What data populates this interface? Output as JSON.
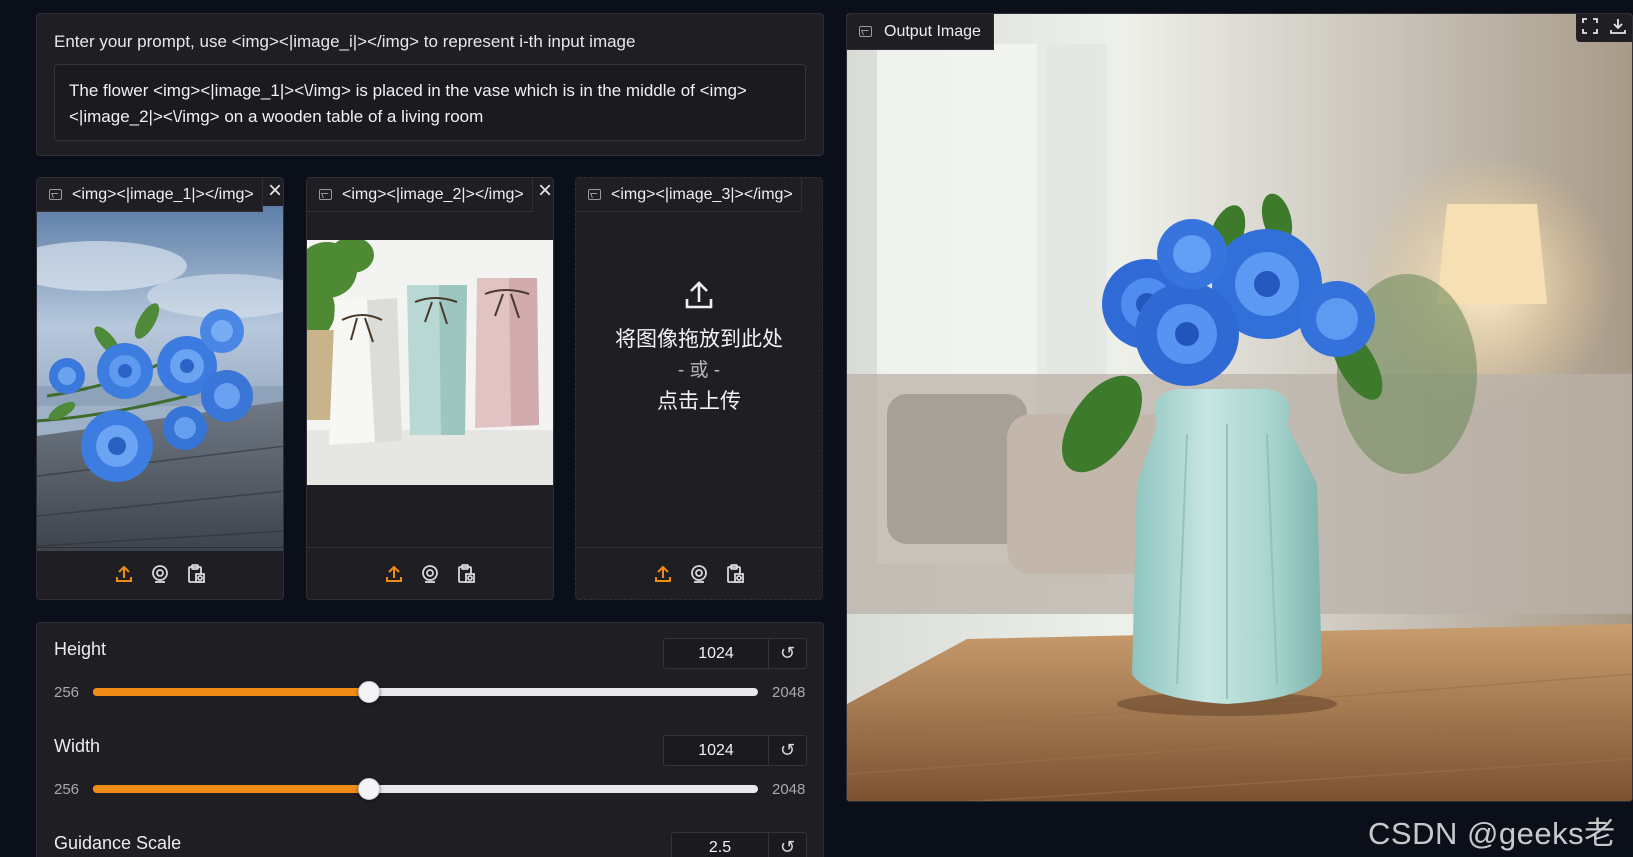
{
  "prompt": {
    "label": "Enter your prompt, use <img><|image_i|></img> to represent i-th input image",
    "value": "The flower <img><|image_1|><\\/img> is placed in the vase which is in the middle of <img><|image_2|><\\/img> on a wooden table of a living room"
  },
  "inputs": [
    {
      "tab": "<img><|image_1|></img>",
      "has_image": true,
      "image": "blue roses bouquet on wooden dock"
    },
    {
      "tab": "<img><|image_2|></img>",
      "has_image": true,
      "image": "three pastel ceramic vases with bows"
    },
    {
      "tab": "<img><|image_3|></img>",
      "has_image": false,
      "drop_text": "将图像拖放到此处",
      "or_text": "- 或 -",
      "click_text": "点击上传"
    }
  ],
  "icons": {
    "upload": "upload-icon",
    "webcam": "webcam-icon",
    "clipboard": "clipboard-icon",
    "close": "close-icon",
    "image": "image-icon",
    "fullscreen": "fullscreen-icon",
    "download": "download-icon",
    "reset": "reset-icon"
  },
  "sliders": {
    "height": {
      "label": "Height",
      "value": "1024",
      "min": "256",
      "max": "2048",
      "reset": "↺"
    },
    "width": {
      "label": "Width",
      "value": "1024",
      "min": "256",
      "max": "2048",
      "reset": "↺"
    },
    "guidance": {
      "label": "Guidance Scale",
      "value": "2.5",
      "reset": "↺"
    }
  },
  "output": {
    "tab": "Output Image",
    "image": "blue roses in mint vase on wooden table"
  },
  "watermark": "CSDN @geeks老师",
  "colors": {
    "accent": "#f08c16",
    "panel": "#1f1f23",
    "background": "#0b0f19"
  }
}
